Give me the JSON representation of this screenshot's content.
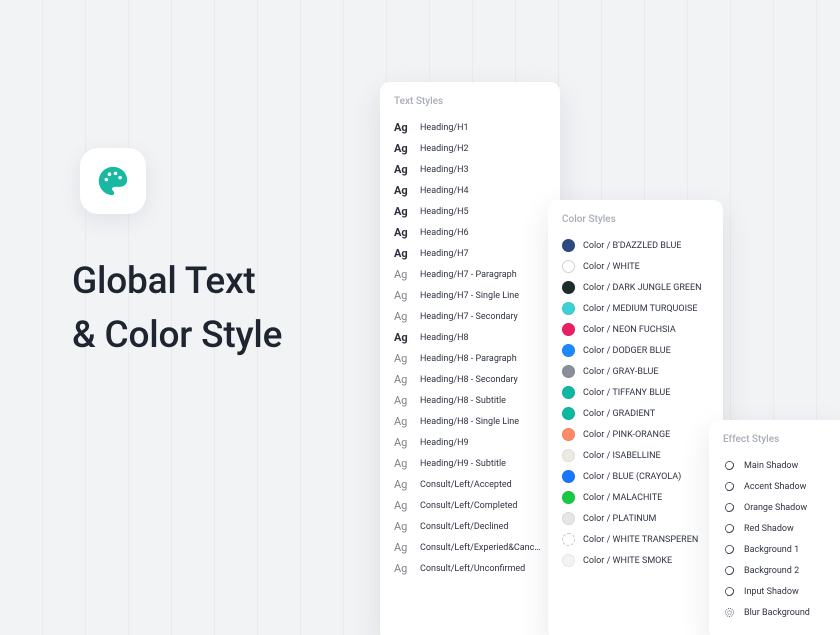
{
  "headline": {
    "line1": "Global Text",
    "line2": "& Color Style"
  },
  "icon": {
    "name": "palette-icon",
    "accent": "#18b9a0"
  },
  "textStyles": {
    "title": "Text Styles",
    "items": [
      {
        "token": "Ag",
        "bold": true,
        "label": "Heading/H1"
      },
      {
        "token": "Ag",
        "bold": true,
        "label": "Heading/H2"
      },
      {
        "token": "Ag",
        "bold": true,
        "label": "Heading/H3"
      },
      {
        "token": "Ag",
        "bold": true,
        "label": "Heading/H4"
      },
      {
        "token": "Ag",
        "bold": true,
        "label": "Heading/H5"
      },
      {
        "token": "Ag",
        "bold": true,
        "label": "Heading/H6"
      },
      {
        "token": "Ag",
        "bold": true,
        "label": "Heading/H7"
      },
      {
        "token": "Ag",
        "bold": false,
        "label": "Heading/H7 - Paragraph"
      },
      {
        "token": "Ag",
        "bold": false,
        "label": "Heading/H7 - Single Line"
      },
      {
        "token": "Ag",
        "bold": false,
        "label": "Heading/H7 - Secondary"
      },
      {
        "token": "Ag",
        "bold": true,
        "label": "Heading/H8"
      },
      {
        "token": "Ag",
        "bold": false,
        "label": "Heading/H8 - Paragraph"
      },
      {
        "token": "Ag",
        "bold": false,
        "label": "Heading/H8 - Secondary"
      },
      {
        "token": "Ag",
        "bold": false,
        "label": "Heading/H8 - Subtitle"
      },
      {
        "token": "Ag",
        "bold": false,
        "label": "Heading/H8 - Single Line"
      },
      {
        "token": "Ag",
        "bold": false,
        "label": "Heading/H9"
      },
      {
        "token": "Ag",
        "bold": false,
        "label": "Heading/H9 - Subtitle"
      },
      {
        "token": "Ag",
        "bold": false,
        "label": "Consult/Left/Accepted"
      },
      {
        "token": "Ag",
        "bold": false,
        "label": "Consult/Left/Completed"
      },
      {
        "token": "Ag",
        "bold": false,
        "label": "Consult/Left/Declined"
      },
      {
        "token": "Ag",
        "bold": false,
        "label": "Consult/Left/Experied&Canc…"
      },
      {
        "token": "Ag",
        "bold": false,
        "label": "Consult/Left/Unconfirmed"
      }
    ]
  },
  "colorStyles": {
    "title": "Color Styles",
    "items": [
      {
        "color": "#2b4b80",
        "label": "Color / B'DAZZLED BLUE"
      },
      {
        "color": "#ffffff",
        "hollow": true,
        "label": "Color / WHITE"
      },
      {
        "color": "#1d2b2b",
        "label": "Color / DARK JUNGLE GREEN"
      },
      {
        "color": "#3fd0d4",
        "label": "Color / MEDIUM TURQUOISE"
      },
      {
        "color": "#e91e63",
        "label": "Color / NEON FUCHSIA"
      },
      {
        "color": "#1e88ff",
        "label": "Color / DODGER BLUE"
      },
      {
        "color": "#8a8f99",
        "label": "Color / GRAY-BLUE"
      },
      {
        "color": "#0fb8a1",
        "label": "Color / TIFFANY BLUE"
      },
      {
        "color": "#0fb8a1",
        "label": "Color / GRADIENT"
      },
      {
        "color": "#ff8a65",
        "label": "Color / PINK-ORANGE"
      },
      {
        "color": "#eceae4",
        "label": "Color / ISABELLINE"
      },
      {
        "color": "#1976ff",
        "label": "Color / BLUE (CRAYOLA)"
      },
      {
        "color": "#17c943",
        "label": "Color / MALACHITE"
      },
      {
        "color": "#e6e6e6",
        "label": "Color / PLATINUM"
      },
      {
        "color": "#ffffff",
        "hollow": true,
        "dashed": true,
        "label": "Color / WHITE TRANSPEREN"
      },
      {
        "color": "#f3f3f3",
        "label": "Color / WHITE SMOKE"
      }
    ]
  },
  "effectStyles": {
    "title": "Effect Styles",
    "items": [
      {
        "kind": "shadow",
        "label": "Main Shadow"
      },
      {
        "kind": "shadow",
        "label": "Accent Shadow"
      },
      {
        "kind": "shadow",
        "label": "Orange Shadow"
      },
      {
        "kind": "shadow",
        "label": "Red Shadow"
      },
      {
        "kind": "shadow",
        "label": "Background 1"
      },
      {
        "kind": "shadow",
        "label": "Background 2"
      },
      {
        "kind": "shadow",
        "label": "Input Shadow"
      },
      {
        "kind": "blur",
        "label": "Blur Background"
      }
    ]
  }
}
